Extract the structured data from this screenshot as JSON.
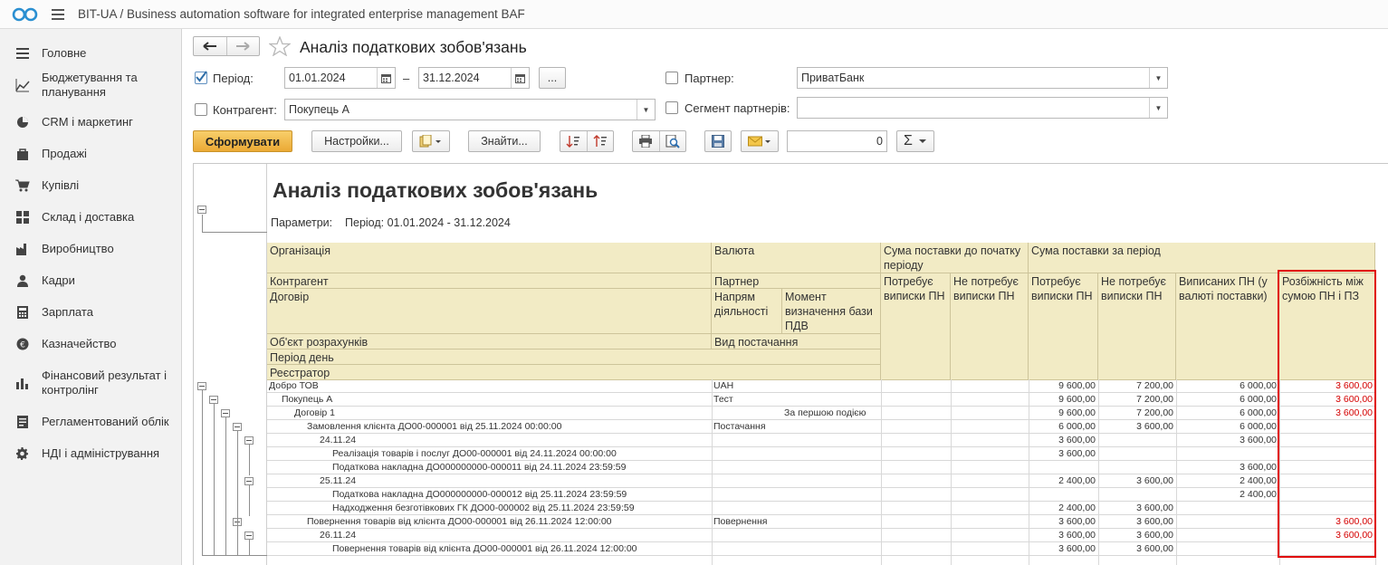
{
  "app": {
    "title": "BIT-UA / Business automation software for integrated enterprise management BAF"
  },
  "sidebar": {
    "items": [
      {
        "label": "Головне",
        "icon": "menu-icon"
      },
      {
        "label": "Бюджетування та планування",
        "icon": "chart-line-icon"
      },
      {
        "label": "CRM і маркетинг",
        "icon": "pie-chart-icon"
      },
      {
        "label": "Продажі",
        "icon": "shopping-bag-icon"
      },
      {
        "label": "Купівлі",
        "icon": "cart-icon"
      },
      {
        "label": "Склад і доставка",
        "icon": "grid-icon"
      },
      {
        "label": "Виробництво",
        "icon": "factory-icon"
      },
      {
        "label": "Кадри",
        "icon": "person-icon"
      },
      {
        "label": "Зарплата",
        "icon": "calculator-icon"
      },
      {
        "label": "Казначейство",
        "icon": "coin-icon"
      },
      {
        "label": "Фінансовий результат і контролінг",
        "icon": "bar-chart-icon"
      },
      {
        "label": "Регламентований облік",
        "icon": "document-icon"
      },
      {
        "label": "НДІ і адміністрування",
        "icon": "gear-icon"
      }
    ]
  },
  "form": {
    "title": "Аналіз податкових зобов'язань",
    "period_label": "Період:",
    "period_checked": true,
    "date_from": "01.01.2024",
    "date_sep": "–",
    "date_to": "31.12.2024",
    "ellipsis": "...",
    "partner_label": "Партнер:",
    "partner_value": "ПриватБанк",
    "counterparty_label": "Контрагент:",
    "counterparty_value": "Покупець А",
    "segment_label": "Сегмент партнерів:",
    "segment_value": "",
    "generate_label": "Сформувати",
    "settings_label": "Настройки...",
    "find_label": "Знайти...",
    "sum_value": "0",
    "sigma": "Σ"
  },
  "report": {
    "title": "Аналіз податкових зобов'язань",
    "params_label": "Параметри:",
    "params_value": "Період: 01.01.2024 - 31.12.2024",
    "headers": {
      "org": "Організація",
      "currency": "Валюта",
      "sum_start": "Сума поставки до початку періоду",
      "sum_period": "Сума поставки за період",
      "counterparty": "Контрагент",
      "partner": "Партнер",
      "contract": "Договір",
      "direction": "Напрям діяльності",
      "vat_moment": "Момент визначення бази ПДВ",
      "needs_tn": "Потребує виписки ПН",
      "no_needs_tn": "Не потребує виписки ПН",
      "needs_tn2": "Потребує виписки ПН",
      "no_needs_tn2": "Не потребує виписки ПН",
      "issued_tn": "Виписаних ПН (у валюті поставки)",
      "diff": "Розбіжність між сумою ПН і ПЗ",
      "settlement": "Об'єкт розрахунків",
      "supply_type": "Вид постачання",
      "period_day": "Період день",
      "registrar": "Реєстратор"
    },
    "rows": [
      {
        "name": "Добро ТОВ",
        "c2": "UAH",
        "c3": "",
        "v1": "9 600,00",
        "v2": "7 200,00",
        "v3": "6 000,00",
        "v4": "3 600,00"
      },
      {
        "name": "Покупець А",
        "c2": "Тест",
        "c3": "",
        "v1": "9 600,00",
        "v2": "7 200,00",
        "v3": "6 000,00",
        "v4": "3 600,00"
      },
      {
        "name": "Договір 1",
        "c2": "",
        "c3": "За першою подією",
        "v1": "9 600,00",
        "v2": "7 200,00",
        "v3": "6 000,00",
        "v4": "3 600,00"
      },
      {
        "name": "Замовлення клієнта ДО00-000001 від 25.11.2024 00:00:00",
        "c2": "Постачання",
        "c3": "",
        "v1": "6 000,00",
        "v2": "3 600,00",
        "v3": "6 000,00",
        "v4": ""
      },
      {
        "name": "24.11.24",
        "c2": "",
        "c3": "",
        "v1": "3 600,00",
        "v2": "",
        "v3": "3 600,00",
        "v4": ""
      },
      {
        "name": "Реалізація товарів і послуг ДО00-000001 від 24.11.2024 00:00:00",
        "c2": "",
        "c3": "",
        "v1": "3 600,00",
        "v2": "",
        "v3": "",
        "v4": ""
      },
      {
        "name": "Податкова накладна ДО000000000-000011 від 24.11.2024 23:59:59",
        "c2": "",
        "c3": "",
        "v1": "",
        "v2": "",
        "v3": "3 600,00",
        "v4": ""
      },
      {
        "name": "25.11.24",
        "c2": "",
        "c3": "",
        "v1": "2 400,00",
        "v2": "3 600,00",
        "v3": "2 400,00",
        "v4": ""
      },
      {
        "name": "Податкова накладна ДО000000000-000012 від 25.11.2024 23:59:59",
        "c2": "",
        "c3": "",
        "v1": "",
        "v2": "",
        "v3": "2 400,00",
        "v4": ""
      },
      {
        "name": "Надходження безготівкових ГК ДО00-000002 від 25.11.2024 23:59:59",
        "c2": "",
        "c3": "",
        "v1": "2 400,00",
        "v2": "3 600,00",
        "v3": "",
        "v4": ""
      },
      {
        "name": "Повернення товарів від клієнта ДО00-000001 від 26.11.2024 12:00:00",
        "c2": "Повернення",
        "c3": "",
        "v1": "3 600,00",
        "v2": "3 600,00",
        "v3": "",
        "v4": "3 600,00"
      },
      {
        "name": "26.11.24",
        "c2": "",
        "c3": "",
        "v1": "3 600,00",
        "v2": "3 600,00",
        "v3": "",
        "v4": "3 600,00"
      },
      {
        "name": "Повернення товарів від клієнта ДО00-000001 від 26.11.2024 12:00:00",
        "c2": "",
        "c3": "",
        "v1": "3 600,00",
        "v2": "3 600,00",
        "v3": "",
        "v4": ""
      }
    ]
  }
}
